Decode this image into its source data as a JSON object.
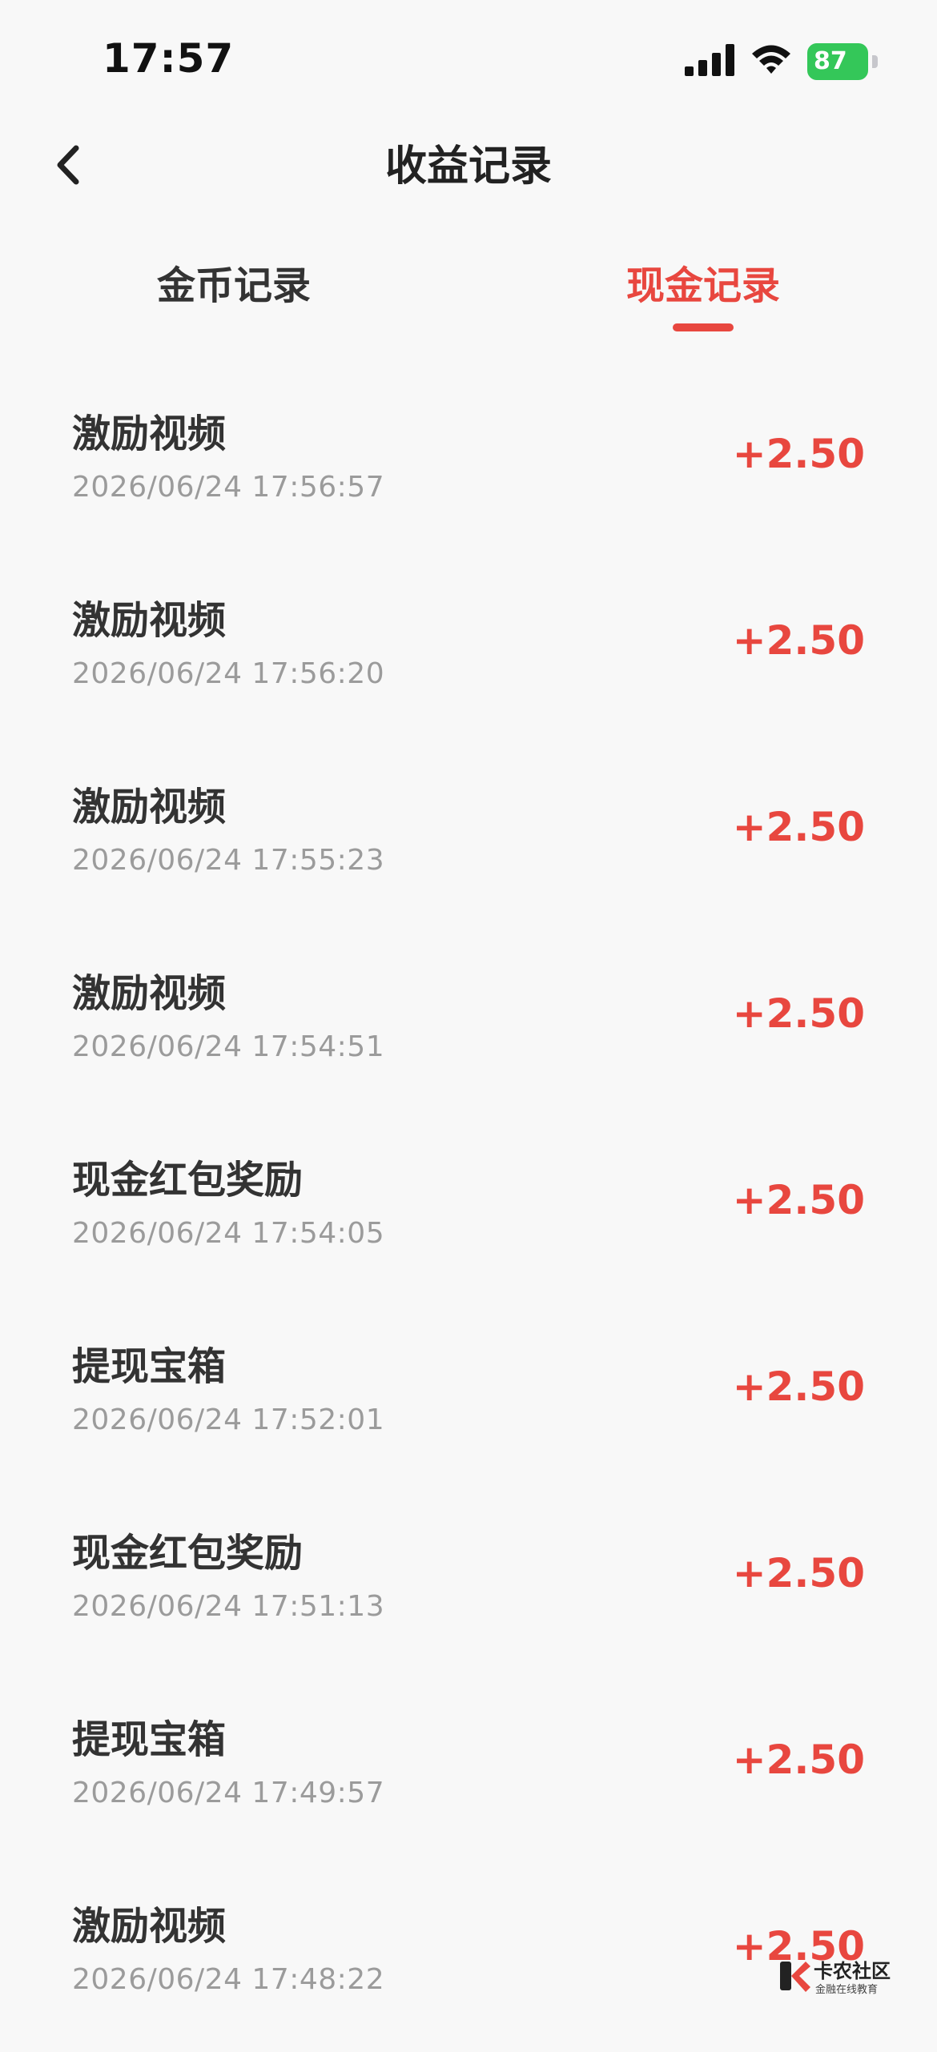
{
  "status_bar": {
    "time": "17:57",
    "battery": "87"
  },
  "nav": {
    "title": "收益记录"
  },
  "tabs": [
    {
      "label": "金币记录",
      "active": false
    },
    {
      "label": "现金记录",
      "active": true
    }
  ],
  "records": [
    {
      "title": "激励视频",
      "time": "2026/06/24 17:56:57",
      "amount": "+2.50"
    },
    {
      "title": "激励视频",
      "time": "2026/06/24 17:56:20",
      "amount": "+2.50"
    },
    {
      "title": "激励视频",
      "time": "2026/06/24 17:55:23",
      "amount": "+2.50"
    },
    {
      "title": "激励视频",
      "time": "2026/06/24 17:54:51",
      "amount": "+2.50"
    },
    {
      "title": "现金红包奖励",
      "time": "2026/06/24 17:54:05",
      "amount": "+2.50"
    },
    {
      "title": "提现宝箱",
      "time": "2026/06/24 17:52:01",
      "amount": "+2.50"
    },
    {
      "title": "现金红包奖励",
      "time": "2026/06/24 17:51:13",
      "amount": "+2.50"
    },
    {
      "title": "提现宝箱",
      "time": "2026/06/24 17:49:57",
      "amount": "+2.50"
    },
    {
      "title": "激励视频",
      "time": "2026/06/24 17:48:22",
      "amount": "+2.50"
    }
  ],
  "watermark": {
    "title": "卡农社区",
    "subtitle": "金融在线教育"
  },
  "colors": {
    "accent": "#e8473f",
    "battery": "#34c759"
  },
  "icons": [
    "signal-icon",
    "wifi-icon",
    "battery-icon",
    "back-chevron-icon"
  ]
}
